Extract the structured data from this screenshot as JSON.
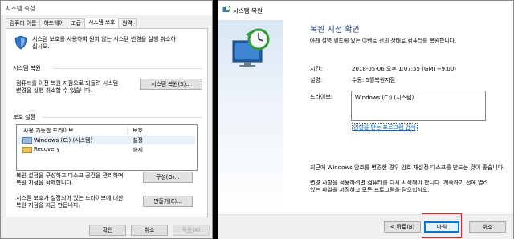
{
  "left": {
    "title": "시스템 속성",
    "tabs": [
      "컴퓨터 이름",
      "하드웨어",
      "고급",
      "시스템 보호",
      "원격"
    ],
    "intro": [
      "시스템 보호를 사용하여 원치 않는 시스템 변경을 실행 취소하",
      "십시오."
    ],
    "restore_section": "시스템 복원",
    "restore_desc": [
      "컴퓨터를 이전 복원 지점으로 되돌려 시스템",
      "변경을 실행 취소할 수 있습니다."
    ],
    "restore_button": "시스템 복원(S)...",
    "protection_section": "보호 설정",
    "col_drive": "사용 가능한 드라이브",
    "col_protection": "보호",
    "drives": [
      {
        "name": "Windows (C:) (시스템)",
        "status": "설정"
      },
      {
        "name": "Recovery",
        "status": "해제"
      }
    ],
    "config_desc": [
      "복원 설정을 구성하고 디스크 공간을 관리하며",
      "복원 지점을 삭제합니다."
    ],
    "config_button": "구성(O)...",
    "create_desc": [
      "시스템 보호가 설정되어 있는 드라이브에 대한",
      "복원 지점을 지금 만듭니다."
    ],
    "create_button": "만들기(C)...",
    "ok": "확인",
    "cancel": "취소",
    "apply": "적용(A)"
  },
  "right": {
    "title": "시스템 복원",
    "heading": "복원 지점 확인",
    "desc": "아래 설명 필드에 있는 이벤트 전의 상태로 컴퓨터를 복원합니다.",
    "time_label": "시간:",
    "time_value": "2018-05-06 오후 1:07:55 (GMT+9:00)",
    "desc_label": "설명:",
    "desc_value": "수동: 5월복원지점",
    "drives_label": "드라이브:",
    "drives_value": "Windows (C:) (시스템)",
    "scan_link": "영향을 받는 프로그램 검색",
    "note1": "최근에 Windows 암호를 변경한 경우 암호 재설정 디스크를 만드는 것이 좋습니다.",
    "note2": [
      "변경 사항을 적용하려면 컴퓨터를 다시 시작해야 합니다. 계속하기 전에 열려",
      "있는 파일을 저장하고 모든 프로그램을 닫으십시오."
    ],
    "back": "< 뒤로(B)",
    "finish": "마침",
    "cancel": "취소"
  },
  "colors": {
    "highlight": "#d9252a",
    "link": "#0066cc",
    "focus": "#0078d7"
  }
}
